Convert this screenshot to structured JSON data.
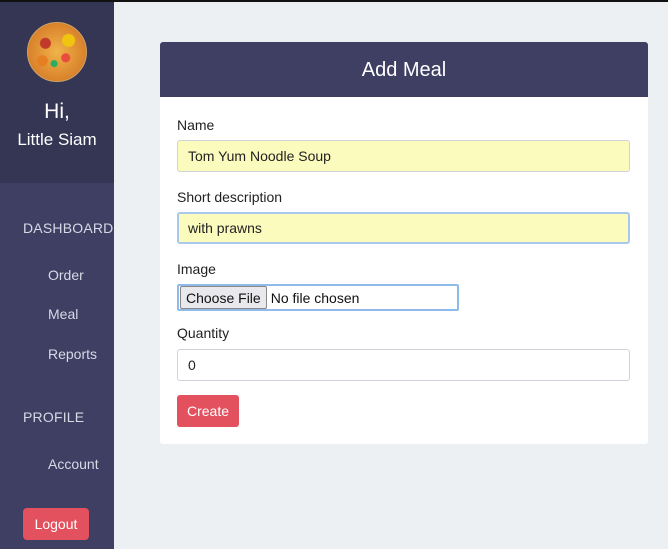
{
  "sidebar": {
    "greeting": "Hi,",
    "restaurant_name": "Little Siam",
    "dashboard_title": "DASHBOARD",
    "dashboard_items": [
      "Order",
      "Meal",
      "Reports"
    ],
    "profile_title": "PROFILE",
    "profile_items": [
      "Account"
    ],
    "logout_label": "Logout"
  },
  "form": {
    "title": "Add Meal",
    "name_label": "Name",
    "name_value": "Tom Yum Noodle Soup",
    "description_label": "Short description",
    "description_value": "with prawns",
    "image_label": "Image",
    "file_button_label": "Choose File",
    "file_status": "No file chosen",
    "quantity_label": "Quantity",
    "quantity_value": "0",
    "submit_label": "Create"
  },
  "colors": {
    "sidebar_bg": "#3f3f63",
    "profile_bg": "#353554",
    "accent_red": "#e4515e",
    "autofill_yellow": "#fbfbbe"
  }
}
